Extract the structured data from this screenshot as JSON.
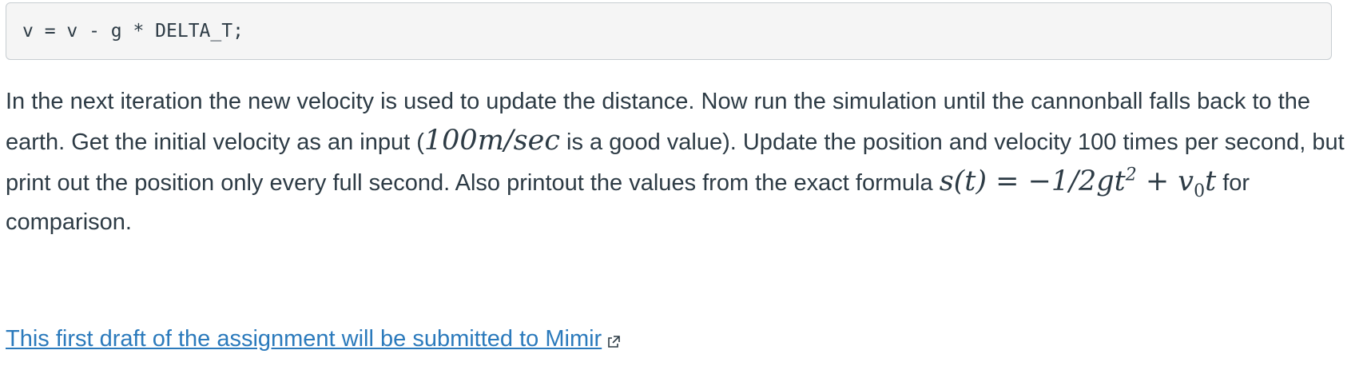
{
  "code": {
    "line": "v = v - g * DELTA_T;"
  },
  "paragraph": {
    "text_1": "In the next iteration the new velocity is used to update the distance. Now run the simulation until the cannonball falls back to the earth. Get the initial velocity as an input (",
    "math_1": "100m/sec",
    "text_2": " is a good value). Update the position and velocity 100 times per second, but print out the position only every full second. Also printout the values from the exact formula ",
    "math_2_main": "s(t) = −1/2gt",
    "math_2_sup": "2",
    "math_2_mid": " + v",
    "math_2_sub": "0",
    "math_2_end": "t",
    "text_3": " for comparison."
  },
  "link": {
    "text": "This first draft of the assignment will be submitted to Mimir",
    "icon": "external-link-icon",
    "color": "#2b7abc"
  }
}
